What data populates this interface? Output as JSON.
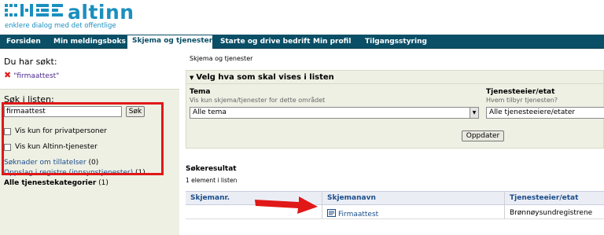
{
  "header": {
    "logo_text": "altinn",
    "tagline": "enklere dialog med det offentlige"
  },
  "nav": {
    "tabs": [
      {
        "label": "Forsiden",
        "active": false
      },
      {
        "label": "Min meldingsboks",
        "active": false
      },
      {
        "label": "Skjema og tjenester",
        "active": true
      },
      {
        "label": "Starte og drive bedrift",
        "active": false
      },
      {
        "label": "Min profil",
        "active": false
      },
      {
        "label": "Tilgangsstyring",
        "active": false
      }
    ]
  },
  "left": {
    "searched_title": "Du har søkt:",
    "searched_term": "\"firmaattest\"",
    "search_label": "Søk i listen:",
    "search_value": "firmaattest",
    "search_button": "Søk",
    "check_private": "Vis kun for privatpersoner",
    "check_altinn": "Vis kun Altinn-tjenester",
    "links": [
      {
        "label": "Søknader om tillatelser",
        "count": "(0)",
        "bold": false
      },
      {
        "label": "Oppslag i registre (innsynstjenester)",
        "count": "(1)",
        "bold": false
      },
      {
        "label": "Alle tjenestekategorier",
        "count": "(1)",
        "bold": true
      }
    ]
  },
  "main": {
    "breadcrumb": "Skjema og tjenester",
    "panel_title": "Velg hva som skal vises i listen",
    "tema_title": "Tema",
    "tema_hint": "Vis kun skjema/tjenester for dette området",
    "tema_value": "Alle tema",
    "eier_title": "Tjenesteeier/etat",
    "eier_hint": "Hvem tilbyr tjenesten?",
    "eier_value": "Alle tjenesteeiere/etater",
    "update_button": "Oppdater",
    "results_title": "Søkeresultat",
    "results_count": "1 element i listen",
    "table": {
      "headers": [
        "Skjemanr.",
        "Skjemanavn",
        "Tjenesteeier/etat"
      ],
      "rows": [
        {
          "nr": "",
          "name": "Firmaattest",
          "owner": "Brønnøysundregistrene"
        }
      ]
    }
  },
  "colors": {
    "brand": "#1b8fbf",
    "nav_bg": "#0a4f66",
    "highlight_red": "#e01818"
  }
}
